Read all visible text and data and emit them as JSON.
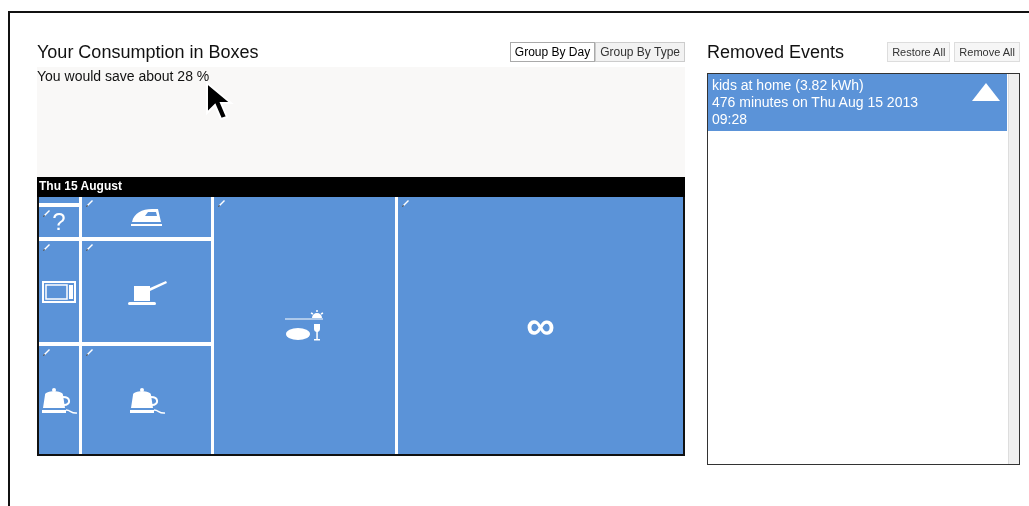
{
  "consumption": {
    "title": "Your Consumption in Boxes",
    "group_buttons": [
      {
        "label": "Group By Day",
        "selected": true
      },
      {
        "label": "Group By Type",
        "selected": false
      }
    ],
    "savings": "You would save about 28 %"
  },
  "day": {
    "label": "Thu 15 August",
    "boxes": [
      {
        "kind": "blank"
      },
      {
        "kind": "question",
        "text": "?"
      },
      {
        "kind": "microwave"
      },
      {
        "kind": "kettle"
      },
      {
        "kind": "iron"
      },
      {
        "kind": "pot"
      },
      {
        "kind": "kettle"
      },
      {
        "kind": "dinner"
      },
      {
        "kind": "infinity",
        "text": "∞"
      }
    ]
  },
  "removed": {
    "title": "Removed Events",
    "buttons": [
      "Restore All",
      "Remove All"
    ],
    "events": [
      {
        "lines": [
          "kids at home (3.82 kWh)",
          "476 minutes on Thu Aug 15 2013",
          "09:28"
        ],
        "selected": true
      }
    ]
  }
}
